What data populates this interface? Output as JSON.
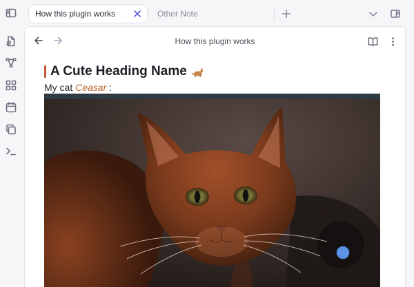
{
  "tabs": [
    {
      "label": "How this plugin works",
      "active": true
    },
    {
      "label": "Other Note",
      "active": false
    }
  ],
  "view": {
    "title": "How this plugin works"
  },
  "note": {
    "heading": "A Cute Heading Name",
    "heading_emoji": "🐈",
    "line_prefix": "My cat ",
    "cat_name": "Ceasar",
    "line_suffix": " :"
  },
  "colors": {
    "accent": "#5b5be0",
    "heading_bar": "#c0593a",
    "italic_text": "#c06a2a",
    "cursor": "#5c93e6"
  },
  "icons": {
    "ribbon": [
      "sidebar-toggle-icon",
      "open-quick-switcher-icon",
      "graph-view-icon",
      "canvas-icon",
      "daily-note-calendar-icon",
      "templates-copy-icon",
      "command-palette-icon"
    ],
    "tabbar": [
      "tab-close-icon",
      "new-tab-icon",
      "tab-list-chevron-icon",
      "right-sidebar-toggle-icon"
    ],
    "view": [
      "back-arrow-icon",
      "forward-arrow-icon",
      "reading-view-book-icon",
      "more-options-icon"
    ]
  }
}
